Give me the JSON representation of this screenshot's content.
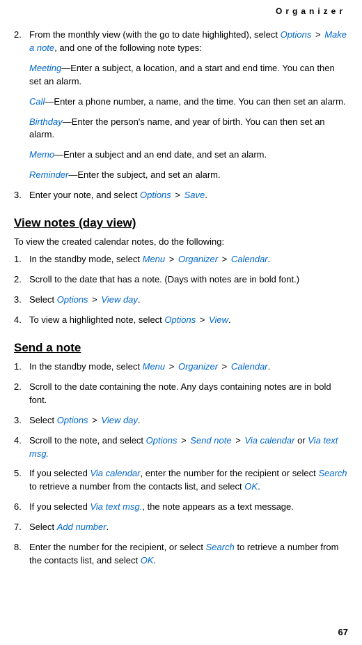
{
  "header": "Organizer",
  "page_number": "67",
  "section1": {
    "items": [
      {
        "num": "2.",
        "intro_a": "From the monthly view (with the go to date highlighted), select ",
        "link1": "Options",
        "gt1": " > ",
        "link2": "Make a note",
        "intro_b": ", and one of the following note types:",
        "sub": [
          {
            "label": "Meeting",
            "text": "—Enter a subject, a location, and a start and end time. You can then set an alarm."
          },
          {
            "label": "Call",
            "text": "—Enter a phone number, a name, and the time. You can then set an alarm."
          },
          {
            "label": "Birthday",
            "text": "—Enter the person's name, and year of birth. You can then set an alarm."
          },
          {
            "label": "Memo",
            "text": "—Enter a subject and an end date, and set an alarm."
          },
          {
            "label": "Reminder",
            "text": "—Enter the subject, and set an alarm."
          }
        ]
      },
      {
        "num": "3.",
        "text_a": "Enter your note, and select ",
        "link1": "Options",
        "gt1": " > ",
        "link2": "Save",
        "text_b": "."
      }
    ]
  },
  "section2": {
    "heading": "View notes (day view)",
    "intro": "To view the created calendar notes, do the following:",
    "items": [
      {
        "num": "1.",
        "a": "In the standby mode, select ",
        "l1": "Menu",
        "g1": " > ",
        "l2": "Organizer",
        "g2": " > ",
        "l3": "Calendar",
        "b": "."
      },
      {
        "num": "2.",
        "a": "Scroll to the date that has a note. (Days with notes are in bold font.)"
      },
      {
        "num": "3.",
        "a": "Select ",
        "l1": "Options",
        "g1": " > ",
        "l2": "View day",
        "b": "."
      },
      {
        "num": "4.",
        "a": "To view a highlighted note, select ",
        "l1": "Options",
        "g1": " > ",
        "l2": "View",
        "b": "."
      }
    ]
  },
  "section3": {
    "heading": "Send a note",
    "items": [
      {
        "num": "1.",
        "a": "In the standby mode, select ",
        "l1": "Menu",
        "g1": " > ",
        "l2": "Organizer",
        "g2": " > ",
        "l3": "Calendar",
        "b": "."
      },
      {
        "num": "2.",
        "a": "Scroll to the date containing the note. Any days containing notes are in bold font."
      },
      {
        "num": "3.",
        "a": "Select ",
        "l1": "Options",
        "g1": " > ",
        "l2": "View day",
        "b": "."
      },
      {
        "num": "4.",
        "a": "Scroll to the note, and select ",
        "l1": "Options",
        "g1": " > ",
        "l2": "Send note",
        "g2": " > ",
        "l3": "Via calendar",
        "mid": " or ",
        "l4": "Via text msg."
      },
      {
        "num": "5.",
        "a": "If you selected ",
        "l1": "Via calendar",
        "mid": ", enter the number for the recipient or select ",
        "l2": "Search",
        "mid2": " to retrieve a number from the contacts list, and select ",
        "l3": "OK",
        "b": "."
      },
      {
        "num": "6.",
        "a": "If you selected ",
        "l1": "Via text msg.",
        "b": ", the note appears as a text message."
      },
      {
        "num": "7.",
        "a": "Select ",
        "l1": "Add number",
        "b": "."
      },
      {
        "num": "8.",
        "a": "Enter the number for the recipient, or select ",
        "l1": "Search",
        "mid": " to retrieve a number from the contacts list, and select ",
        "l2": "OK",
        "b": "."
      }
    ]
  }
}
